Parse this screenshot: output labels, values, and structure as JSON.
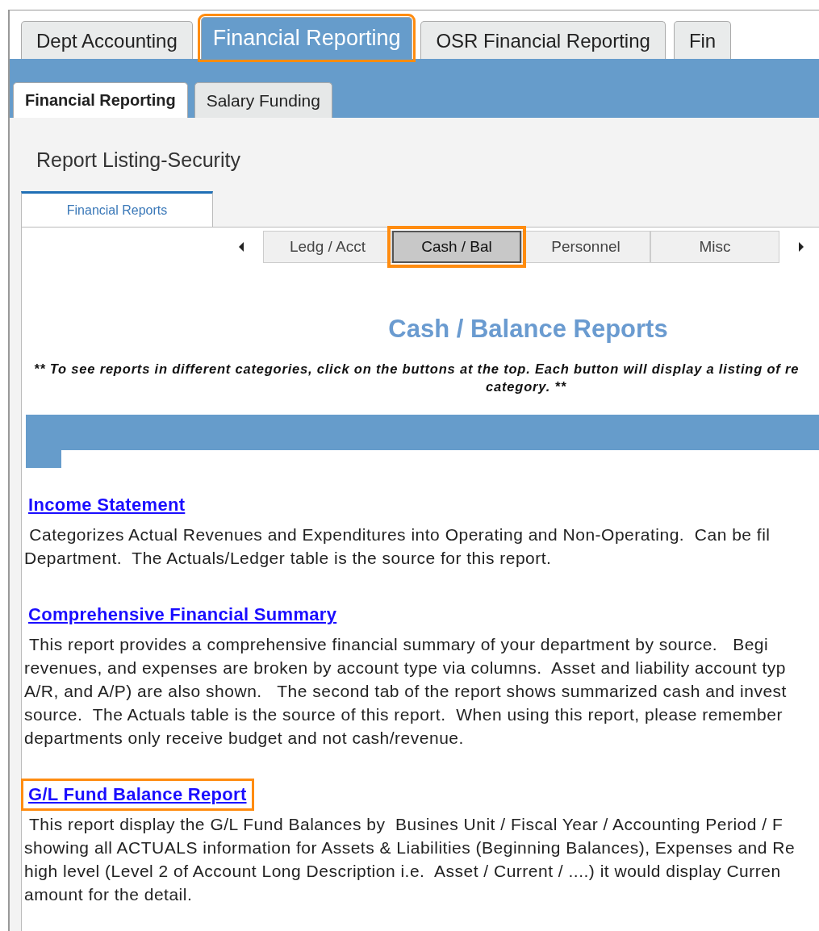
{
  "main_tabs": [
    {
      "label": "Dept Accounting",
      "selected": false,
      "highlighted": false
    },
    {
      "label": "Financial Reporting",
      "selected": true,
      "highlighted": true
    },
    {
      "label": "OSR Financial Reporting",
      "selected": false,
      "highlighted": false
    },
    {
      "label": "Fin",
      "selected": false,
      "highlighted": false
    }
  ],
  "sub_tabs": [
    {
      "label": "Financial Reporting",
      "selected": true
    },
    {
      "label": "Salary Funding",
      "selected": false
    }
  ],
  "page_title": "Report Listing-Security",
  "section_tabs": [
    {
      "label": "Financial Reports",
      "selected": true
    }
  ],
  "category_buttons": [
    {
      "label": "Ledg / Acct",
      "selected": false,
      "highlighted": false
    },
    {
      "label": "Cash / Bal",
      "selected": true,
      "highlighted": true
    },
    {
      "label": "Personnel",
      "selected": false,
      "highlighted": false
    },
    {
      "label": "Misc",
      "selected": false,
      "highlighted": false
    }
  ],
  "heading": "Cash / Balance Reports",
  "intro_lines": [
    "** To see reports in different categories, click on the buttons at the top.  Each button will display a listing of re",
    "category. **"
  ],
  "reports": [
    {
      "title": "Income Statement",
      "highlighted": false,
      "description_lines": [
        " Categorizes Actual Revenues and Expenditures into Operating and Non-Operating.  Can be fil",
        "Department.  The Actuals/Ledger table is the source for this report."
      ]
    },
    {
      "title": "Comprehensive Financial Summary",
      "highlighted": false,
      "description_lines": [
        " This report provides a comprehensive financial summary of your department by source.   Begi",
        "revenues, and expenses are broken by account type via columns.  Asset and liability account typ",
        "A/R, and A/P) are also shown.   The second tab of the report shows summarized cash and invest",
        "source.  The Actuals table is the source of this report.  When using this report, please remember",
        "departments only receive budget and not cash/revenue."
      ]
    },
    {
      "title": "G/L Fund Balance Report",
      "highlighted": true,
      "description_lines": [
        " This report display the G/L Fund Balances by  Busines Unit / Fiscal Year / Accounting Period / F",
        "showing all ACTUALS information for Assets & Liabilities (Beginning Balances), Expenses and Re",
        "high level (Level 2 of Account Long Description i.e.  Asset / Current / ....) it would display Curren",
        "amount for the detail."
      ]
    }
  ]
}
